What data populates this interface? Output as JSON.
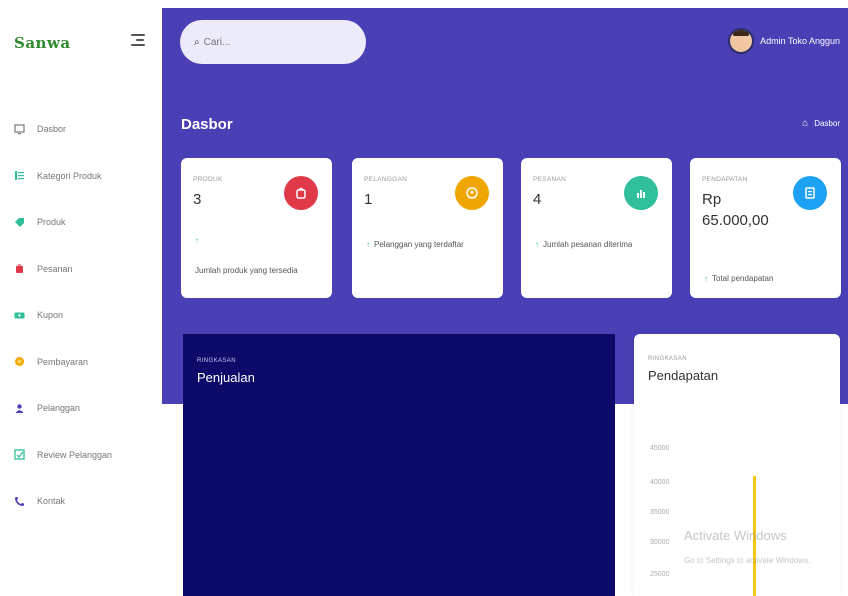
{
  "sidebar": {
    "logo_text": "Sanwa",
    "items": [
      {
        "label": "Dasbor",
        "icon": "monitor-icon",
        "color": "#777777"
      },
      {
        "label": "Kategori Produk",
        "icon": "list-icon",
        "color": "#2fbf9a"
      },
      {
        "label": "Produk",
        "icon": "tag-icon",
        "color": "#2fbf9a"
      },
      {
        "label": "Pesanan",
        "icon": "bag-icon",
        "color": "#e0394a"
      },
      {
        "label": "Kupon",
        "icon": "ticket-icon",
        "color": "#2fbf9a"
      },
      {
        "label": "Pembayaran",
        "icon": "coin-icon",
        "color": "#f0a500"
      },
      {
        "label": "Pelanggan",
        "icon": "users-icon",
        "color": "#4a3fb5"
      },
      {
        "label": "Review Pelanggan",
        "icon": "review-icon",
        "color": "#2fbf9a"
      },
      {
        "label": "Kontak",
        "icon": "phone-icon",
        "color": "#4a3fb5"
      }
    ]
  },
  "header": {
    "search_placeholder": "Cari...",
    "user_name": "Admin Toko Anggun"
  },
  "page": {
    "title": "Dasbor",
    "breadcrumb": "Dasbor"
  },
  "cards": [
    {
      "label": "Produk",
      "value": "3",
      "footer": "Jumlah produk yang tersedia",
      "color": "#e0394a",
      "icon": "bag-icon"
    },
    {
      "label": "Pelanggan",
      "value": "1",
      "footer": "Pelanggan yang terdaftar",
      "color": "#f0a500",
      "icon": "user-icon"
    },
    {
      "label": "Pesanan",
      "value": "4",
      "footer": "Jumlah pesanan diterima",
      "color": "#2fbf9a",
      "icon": "bar-chart-icon"
    },
    {
      "label": "Pendapatan",
      "value_line1": "Rp",
      "value_line2": "65.000,00",
      "footer": "Total pendapatan",
      "color": "#1da1f2",
      "icon": "document-icon"
    }
  ],
  "charts": {
    "sales": {
      "label": "Ringkasan",
      "title": "Penjualan"
    },
    "revenue": {
      "label": "Ringkasan",
      "title": "Pendapatan",
      "ticks": [
        "45000",
        "40000",
        "35000",
        "30000",
        "25000"
      ],
      "bar_color": "#f5c518"
    }
  },
  "watermark": {
    "line1": "Activate Windows",
    "line2": "Go to Settings to activate Windows."
  }
}
